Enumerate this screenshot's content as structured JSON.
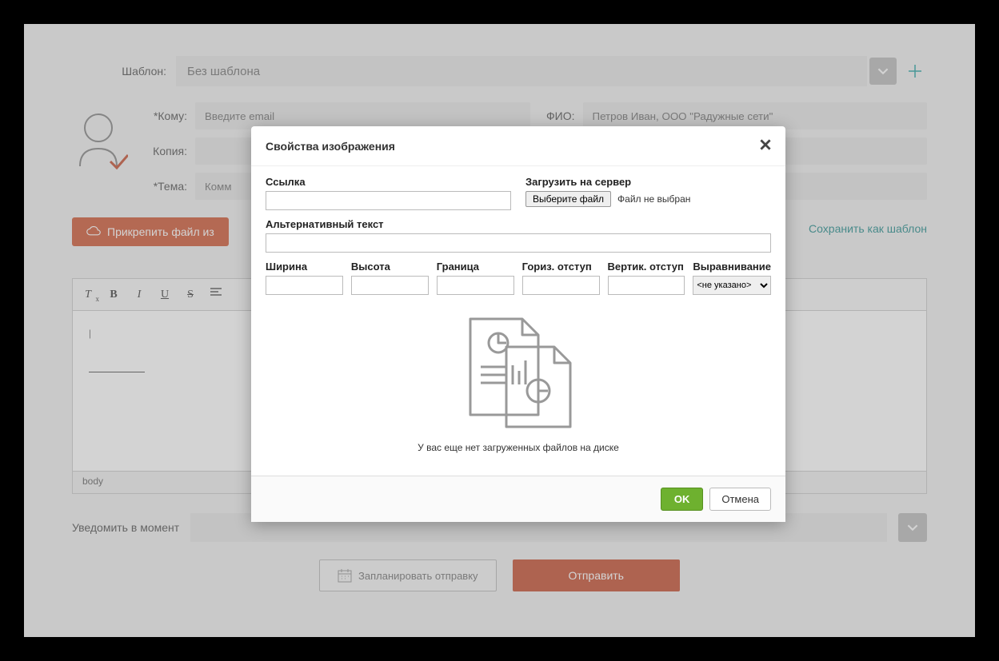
{
  "template": {
    "label": "Шаблон:",
    "value": "Без шаблона"
  },
  "to": {
    "label": "*Кому:",
    "placeholder": "Введите email"
  },
  "fio": {
    "label": "ФИО:",
    "placeholder": "Петров Иван, ООО \"Радужные сети\""
  },
  "copy": {
    "label": "Копия:"
  },
  "subject": {
    "label": "*Тема:",
    "placeholder": "Комм"
  },
  "attach": "Прикрепить файл из",
  "save_template": "Сохранить как шаблон",
  "editor_cursor": "|",
  "editor_path": "body",
  "notify": "Уведомить в момент",
  "schedule": "Запланировать отправку",
  "send": "Отправить",
  "modal": {
    "title": "Свойства изображения",
    "url_label": "Ссылка",
    "upload_label": "Загрузить на сервер",
    "file_btn": "Выберите файл",
    "file_status": "Файл не выбран",
    "alt_label": "Альтернативный текст",
    "width": "Ширина",
    "height": "Высота",
    "border": "Граница",
    "hspace": "Гориз. отступ",
    "vspace": "Вертик. отступ",
    "align": "Выравнивание",
    "align_value": "<не указано>",
    "empty_msg": "У вас еще нет загруженных файлов на диске",
    "ok": "OK",
    "cancel": "Отмена"
  }
}
